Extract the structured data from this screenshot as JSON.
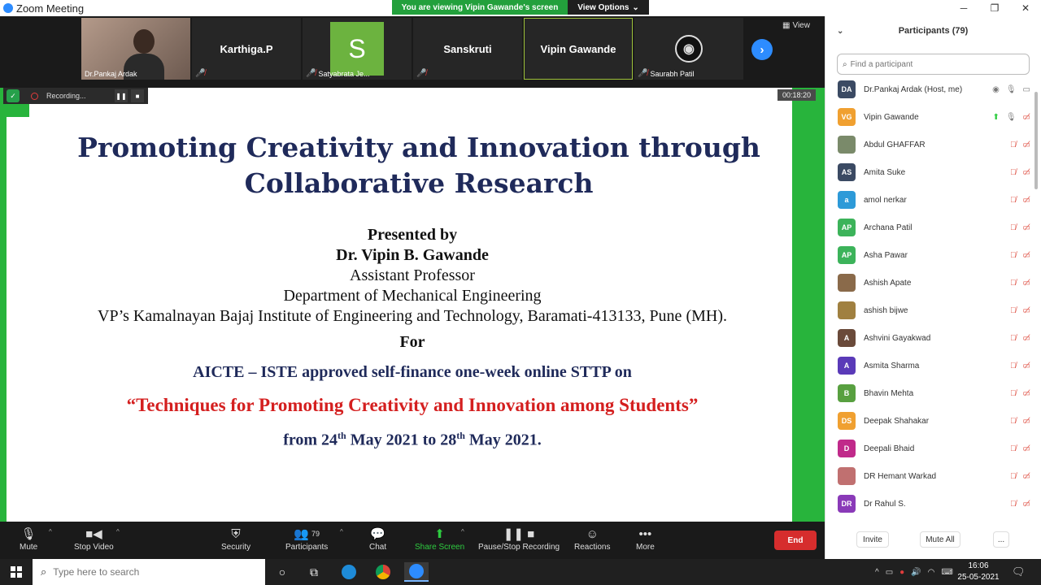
{
  "window": {
    "title": "Zoom Meeting",
    "viewing_banner": "You are viewing Vipin Gawande's screen",
    "view_options_label": "View Options",
    "minimize_glyph": "─",
    "maximize_glyph": "❐",
    "close_glyph": "✕"
  },
  "strip": {
    "tiles": [
      {
        "name": "Dr.Pankaj Ardak",
        "type": "video"
      },
      {
        "name": "Karthiga.P",
        "type": "name"
      },
      {
        "name": "Satyabrata Je...",
        "type": "avatar",
        "initial": "S",
        "color": "#6cb33f"
      },
      {
        "name": "Sanskruti",
        "type": "name"
      },
      {
        "name": "Vipin Gawande",
        "type": "name",
        "active": true
      },
      {
        "name": "Saurabh Patil",
        "type": "obs"
      }
    ],
    "view_label": "View",
    "next_glyph": "›"
  },
  "recording": {
    "label": "Recording...",
    "pause_glyph": "❚❚",
    "stop_glyph": "■",
    "timer": "00:18:20"
  },
  "slide": {
    "title_line1": "Promoting Creativity and Innovation through",
    "title_line2": "Collaborative Research",
    "presented_by": "Presented by",
    "presenter": "Dr. Vipin B. Gawande",
    "designation": "Assistant Professor",
    "department": "Department of Mechanical Engineering",
    "institute": "VP’s Kamalnayan Bajaj Institute of Engineering and Technology, Baramati-413133, Pune (MH).",
    "for": "For",
    "program": "AICTE – ISTE approved self-finance one-week online STTP on",
    "topic": "“Techniques for Promoting Creativity and Innovation among Students”",
    "dates_from": "from 24",
    "dates_sup1": "th",
    "dates_mid": " May 2021 to 28",
    "dates_sup2": "th",
    "dates_end": " May 2021."
  },
  "toolbar": {
    "mute": "Mute",
    "stop_video": "Stop Video",
    "security": "Security",
    "participants": "Participants",
    "participants_count": "79",
    "chat": "Chat",
    "share_screen": "Share Screen",
    "pause_stop_recording": "Pause/Stop Recording",
    "reactions": "Reactions",
    "more": "More",
    "end": "End"
  },
  "panel": {
    "title": "Participants (79)",
    "search_placeholder": "Find a participant",
    "participants": [
      {
        "name": "Dr.Pankaj Ardak (Host, me)",
        "initials": "DA",
        "color": "#3b4a63",
        "muted": false,
        "host": true
      },
      {
        "name": "Vipin Gawande",
        "initials": "VG",
        "color": "#f0a030",
        "muted": false,
        "sharing": true
      },
      {
        "name": "Abdul GHAFFAR",
        "initials": "",
        "color": "#7a8a6a",
        "muted": true
      },
      {
        "name": "Amita Suke",
        "initials": "AS",
        "color": "#3b4a63",
        "muted": true
      },
      {
        "name": "amol nerkar",
        "initials": "a",
        "color": "#2d9ad8",
        "muted": true
      },
      {
        "name": "Archana Patil",
        "initials": "AP",
        "color": "#3cb35a",
        "muted": true
      },
      {
        "name": "Asha Pawar",
        "initials": "AP",
        "color": "#3cb35a",
        "muted": true
      },
      {
        "name": "Ashish Apate",
        "initials": "",
        "color": "#8a6a4a",
        "muted": true
      },
      {
        "name": "ashish bijwe",
        "initials": "",
        "color": "#a08040",
        "muted": true
      },
      {
        "name": "Ashvini Gayakwad",
        "initials": "A",
        "color": "#6a4a3a",
        "muted": true
      },
      {
        "name": "Asmita Sharma",
        "initials": "A",
        "color": "#5a3ab8",
        "muted": true
      },
      {
        "name": "Bhavin Mehta",
        "initials": "B",
        "color": "#58a040",
        "muted": true
      },
      {
        "name": "Deepak Shahakar",
        "initials": "DS",
        "color": "#f0a030",
        "muted": true
      },
      {
        "name": "Deepali Bhaid",
        "initials": "D",
        "color": "#c02a8a",
        "muted": true
      },
      {
        "name": "DR Hemant Warkad",
        "initials": "",
        "color": "#c07070",
        "muted": true
      },
      {
        "name": "Dr Rahul S.",
        "initials": "DR",
        "color": "#8a3ab8",
        "muted": true
      }
    ],
    "invite": "Invite",
    "mute_all": "Mute All",
    "more": "..."
  },
  "taskbar": {
    "search_placeholder": "Type here to search",
    "time": "16:06",
    "date": "25-05-2021"
  }
}
